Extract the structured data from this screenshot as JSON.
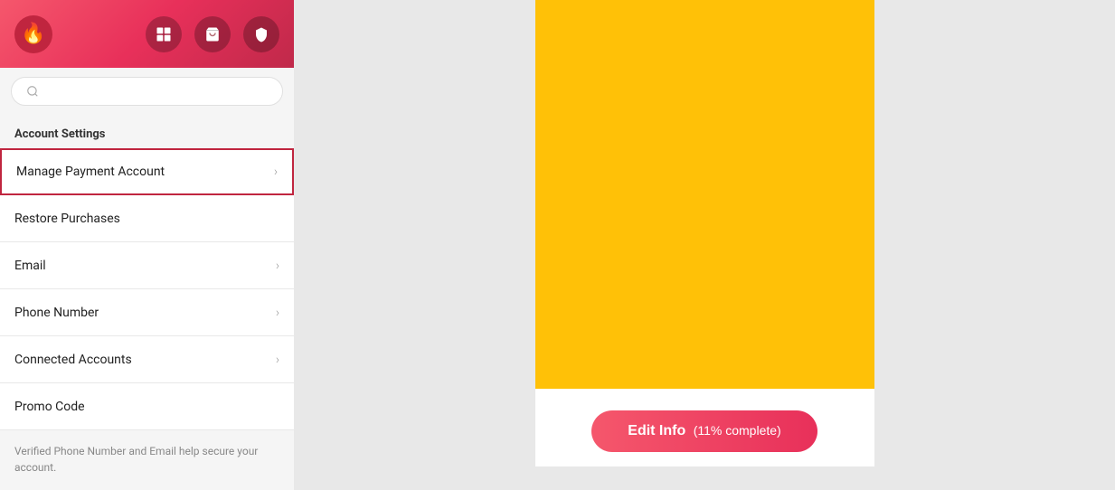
{
  "nav": {
    "logo_icon": "🔥",
    "icons": [
      {
        "name": "browse-icon",
        "symbol": "⊞",
        "label": "Browse"
      },
      {
        "name": "bag-icon",
        "symbol": "💼",
        "label": "Bag"
      },
      {
        "name": "shield-icon",
        "symbol": "🛡",
        "label": "Shield"
      }
    ]
  },
  "sidebar": {
    "section_title": "Account Settings",
    "menu_items": [
      {
        "id": "manage-payment",
        "label": "Manage Payment Account",
        "has_arrow": true,
        "highlighted": true
      },
      {
        "id": "restore-purchases",
        "label": "Restore Purchases",
        "has_arrow": false,
        "highlighted": false
      },
      {
        "id": "email",
        "label": "Email",
        "has_arrow": true,
        "highlighted": false
      },
      {
        "id": "phone-number",
        "label": "Phone Number",
        "has_arrow": true,
        "highlighted": false
      },
      {
        "id": "connected-accounts",
        "label": "Connected Accounts",
        "has_arrow": true,
        "highlighted": false
      },
      {
        "id": "promo-code",
        "label": "Promo Code",
        "has_arrow": false,
        "highlighted": false
      }
    ],
    "footer_note": "Verified Phone Number and Email help secure your account."
  },
  "main": {
    "edit_btn_label": "Edit Info",
    "edit_btn_progress": "(11% complete)"
  }
}
